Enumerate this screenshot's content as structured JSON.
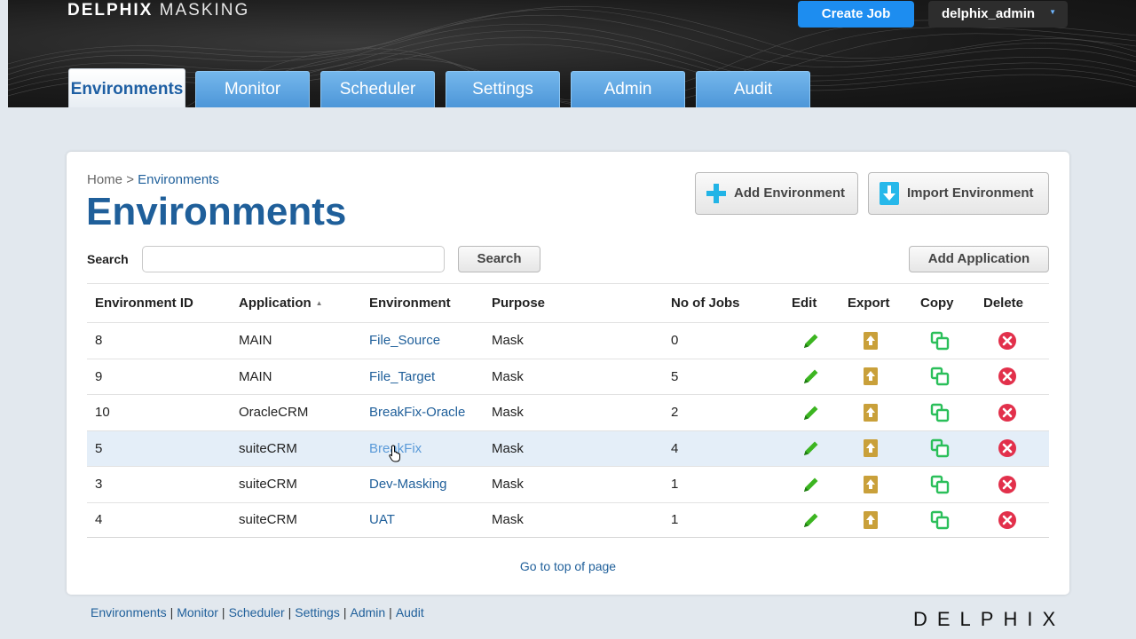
{
  "header": {
    "brand_bold": "DELPHIX",
    "brand_light": "MASKING",
    "create_job_label": "Create Job",
    "user_label": "delphix_admin",
    "user_caret": "▼"
  },
  "tabs": [
    {
      "label": "Environments",
      "active": true
    },
    {
      "label": "Monitor"
    },
    {
      "label": "Scheduler"
    },
    {
      "label": "Settings"
    },
    {
      "label": "Admin"
    },
    {
      "label": "Audit"
    }
  ],
  "main": {
    "breadcrumb_home": "Home",
    "breadcrumb_sep": ">",
    "breadcrumb_current": "Environments",
    "title": "Environments",
    "add_env_label": "Add Environment",
    "import_env_label": "Import Environment",
    "search_label": "Search",
    "search_value": "",
    "search_button": "Search",
    "add_app_label": "Add Application",
    "go_top": "Go to top of page"
  },
  "table": {
    "headers": [
      "Environment ID",
      "Application",
      "Environment",
      "Purpose",
      "No of Jobs",
      "Edit",
      "Export",
      "Copy",
      "Delete"
    ],
    "sort_indicator": "▲",
    "rows": [
      {
        "id": "8",
        "application": "MAIN",
        "environment": "File_Source",
        "purpose": "Mask",
        "jobs": "0"
      },
      {
        "id": "9",
        "application": "MAIN",
        "environment": "File_Target",
        "purpose": "Mask",
        "jobs": "5"
      },
      {
        "id": "10",
        "application": "OracleCRM",
        "environment": "BreakFix-Oracle",
        "purpose": "Mask",
        "jobs": "2"
      },
      {
        "id": "5",
        "application": "suiteCRM",
        "environment": "BreakFix",
        "purpose": "Mask",
        "jobs": "4"
      },
      {
        "id": "3",
        "application": "suiteCRM",
        "environment": "Dev-Masking",
        "purpose": "Mask",
        "jobs": "1"
      },
      {
        "id": "4",
        "application": "suiteCRM",
        "environment": "UAT",
        "purpose": "Mask",
        "jobs": "1"
      }
    ],
    "hover_row": 3
  },
  "footer": {
    "links": [
      "Environments",
      "Monitor",
      "Scheduler",
      "Settings",
      "Admin",
      "Audit"
    ],
    "separator": "|",
    "logo": "DELPHIX"
  },
  "colors": {
    "accent": "#1f5f9a",
    "primary_button": "#1d8df0",
    "tab": "#5ea6e2",
    "edit_icon": "#3cb521",
    "export_icon": "#c9a03a",
    "copy_icon": "#2bbf5a",
    "delete_icon": "#e2304b"
  },
  "icons": {
    "add_env": "plus-icon",
    "import_env": "import-icon",
    "edit": "pencil-icon",
    "export": "export-icon",
    "copy": "copy-icon",
    "delete": "delete-icon"
  }
}
